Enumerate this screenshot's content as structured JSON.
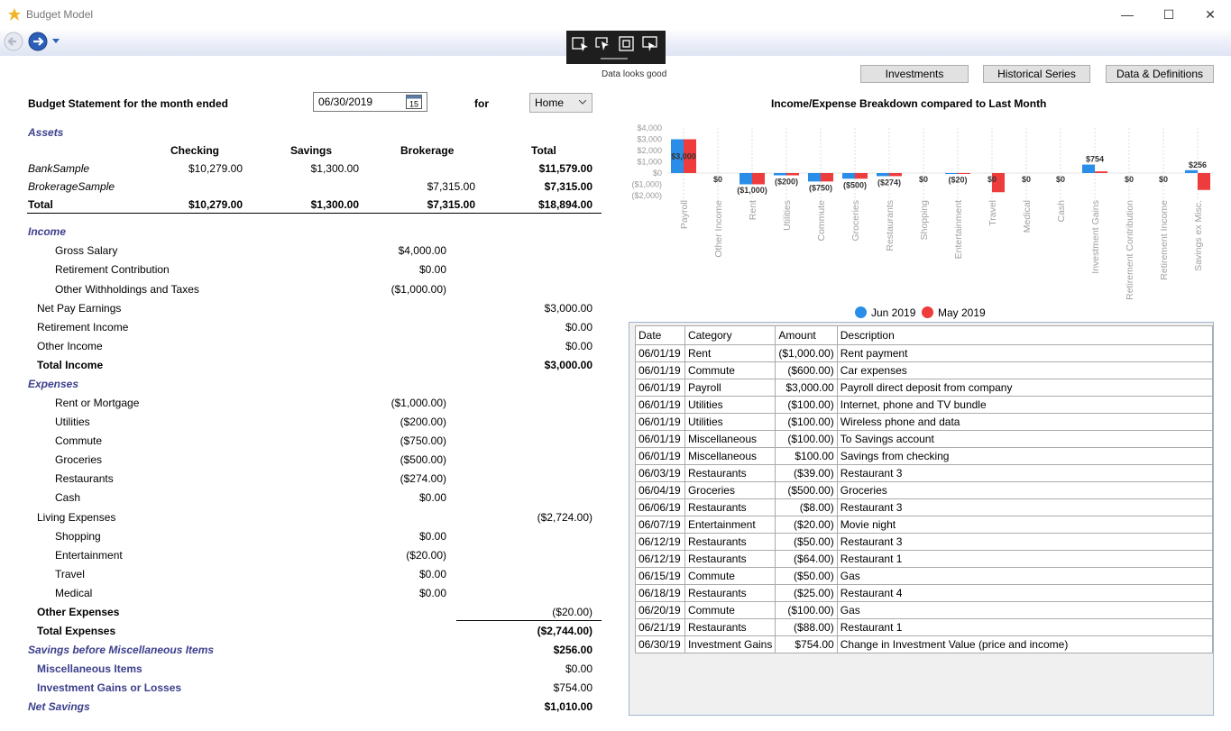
{
  "window": {
    "title": "Budget Model",
    "minimize": "—",
    "maximize": "☐",
    "close": "✕"
  },
  "toolbar": {
    "status": "Data looks good"
  },
  "top_buttons": {
    "investments": "Investments",
    "historical": "Historical Series",
    "data_defs": "Data & Definitions"
  },
  "statement": {
    "heading": "Budget Statement for the month ended",
    "date": "06/30/2019",
    "calendar_day": "15",
    "for_label": "for",
    "scope": "Home",
    "assets_label": "Assets",
    "columns": [
      "Checking",
      "Savings",
      "Brokerage",
      "Total"
    ],
    "assets": [
      {
        "name": "BankSample",
        "checking": "$10,279.00",
        "savings": "$1,300.00",
        "brokerage": "",
        "total": "$11,579.00"
      },
      {
        "name": "BrokerageSample",
        "checking": "",
        "savings": "",
        "brokerage": "$7,315.00",
        "total": "$7,315.00"
      },
      {
        "name": "Total",
        "checking": "$10,279.00",
        "savings": "$1,300.00",
        "brokerage": "$7,315.00",
        "total": "$18,894.00"
      }
    ],
    "income_label": "Income",
    "gross_salary": {
      "label": "Gross Salary",
      "value": "$4,000.00"
    },
    "retirement_contribution": {
      "label": "Retirement Contribution",
      "value": "$0.00"
    },
    "other_withholdings": {
      "label": "Other Withholdings and Taxes",
      "value": "($1,000.00)"
    },
    "net_pay": {
      "label": "Net Pay Earnings",
      "value": "$3,000.00"
    },
    "retirement_income": {
      "label": "Retirement Income",
      "value": "$0.00"
    },
    "other_income": {
      "label": "Other Income",
      "value": "$0.00"
    },
    "total_income": {
      "label": "Total Income",
      "value": "$3,000.00"
    },
    "expenses_label": "Expenses",
    "rent": {
      "label": "Rent or Mortgage",
      "value": "($1,000.00)"
    },
    "utilities": {
      "label": "Utilities",
      "value": "($200.00)"
    },
    "commute": {
      "label": "Commute",
      "value": "($750.00)"
    },
    "groceries": {
      "label": "Groceries",
      "value": "($500.00)"
    },
    "restaurants": {
      "label": "Restaurants",
      "value": "($274.00)"
    },
    "cash": {
      "label": "Cash",
      "value": "$0.00"
    },
    "living_expenses": {
      "label": "Living Expenses",
      "value": "($2,724.00)"
    },
    "shopping": {
      "label": "Shopping",
      "value": "$0.00"
    },
    "entertainment": {
      "label": "Entertainment",
      "value": "($20.00)"
    },
    "travel": {
      "label": "Travel",
      "value": "$0.00"
    },
    "medical": {
      "label": "Medical",
      "value": "$0.00"
    },
    "other_expenses": {
      "label": "Other Expenses",
      "value": "($20.00)"
    },
    "total_expenses": {
      "label": "Total Expenses",
      "value": "($2,744.00)"
    },
    "savings_before_misc": {
      "label": "Savings before Miscellaneous Items",
      "value": "$256.00"
    },
    "misc_items": {
      "label": "Miscellaneous Items",
      "value": "$0.00"
    },
    "investment_gains": {
      "label": "Investment Gains or Losses",
      "value": "$754.00"
    },
    "net_savings": {
      "label": "Net Savings",
      "value": "$1,010.00"
    }
  },
  "colors": {
    "jun": "#2a8de8",
    "may": "#ee3b3b",
    "section_label": "#3c3f8c"
  },
  "chart_data": {
    "type": "bar",
    "title": "Income/Expense Breakdown compared to Last Month",
    "categories": [
      "Payroll",
      "Other Income",
      "Rent",
      "Utilities",
      "Commute",
      "Groceries",
      "Restaurants",
      "Shopping",
      "Entertainment",
      "Travel",
      "Medical",
      "Cash",
      "Investment Gains",
      "Retirement Contribution",
      "Retirement Income",
      "Savings ex Misc."
    ],
    "series": [
      {
        "name": "Jun 2019",
        "values": [
          3000,
          0,
          -1000,
          -200,
          -750,
          -500,
          -274,
          0,
          -20,
          0,
          0,
          0,
          754,
          0,
          0,
          256
        ]
      },
      {
        "name": "May 2019",
        "values": [
          3000,
          0,
          -1000,
          -200,
          -750,
          -500,
          -274,
          0,
          -20,
          -1700,
          0,
          0,
          150,
          0,
          0,
          -1500
        ]
      }
    ],
    "data_labels": [
      "$3,000",
      "$0",
      "($1,000)",
      "($200)",
      "($750)",
      "($500)",
      "($274)",
      "$0",
      "($20)",
      "$0",
      "$0",
      "$0",
      "$754",
      "$0",
      "$0",
      "$256"
    ],
    "y_ticks": [
      "$4,000",
      "$3,000",
      "$2,000",
      "$1,000",
      "$0",
      "($1,000)",
      "($2,000)"
    ],
    "ylim": [
      -2000,
      4000
    ],
    "legend": "bottom"
  },
  "transactions": {
    "headers": [
      "Date",
      "Category",
      "Amount",
      "Description"
    ],
    "rows": [
      [
        "06/01/19",
        "Rent",
        "($1,000.00)",
        "Rent payment"
      ],
      [
        "06/01/19",
        "Commute",
        "($600.00)",
        "Car expenses"
      ],
      [
        "06/01/19",
        "Payroll",
        "$3,000.00",
        "Payroll direct deposit from company"
      ],
      [
        "06/01/19",
        "Utilities",
        "($100.00)",
        "Internet, phone and TV bundle"
      ],
      [
        "06/01/19",
        "Utilities",
        "($100.00)",
        "Wireless phone and data"
      ],
      [
        "06/01/19",
        "Miscellaneous",
        "($100.00)",
        "To Savings account"
      ],
      [
        "06/01/19",
        "Miscellaneous",
        "$100.00",
        "Savings from checking"
      ],
      [
        "06/03/19",
        "Restaurants",
        "($39.00)",
        "Restaurant 3"
      ],
      [
        "06/04/19",
        "Groceries",
        "($500.00)",
        "Groceries"
      ],
      [
        "06/06/19",
        "Restaurants",
        "($8.00)",
        "Restaurant 3"
      ],
      [
        "06/07/19",
        "Entertainment",
        "($20.00)",
        "Movie night"
      ],
      [
        "06/12/19",
        "Restaurants",
        "($50.00)",
        "Restaurant 3"
      ],
      [
        "06/12/19",
        "Restaurants",
        "($64.00)",
        "Restaurant 1"
      ],
      [
        "06/15/19",
        "Commute",
        "($50.00)",
        "Gas"
      ],
      [
        "06/18/19",
        "Restaurants",
        "($25.00)",
        "Restaurant 4"
      ],
      [
        "06/20/19",
        "Commute",
        "($100.00)",
        "Gas"
      ],
      [
        "06/21/19",
        "Restaurants",
        "($88.00)",
        "Restaurant 1"
      ],
      [
        "06/30/19",
        "Investment Gains",
        "$754.00",
        "Change in Investment Value (price and income)"
      ]
    ]
  }
}
